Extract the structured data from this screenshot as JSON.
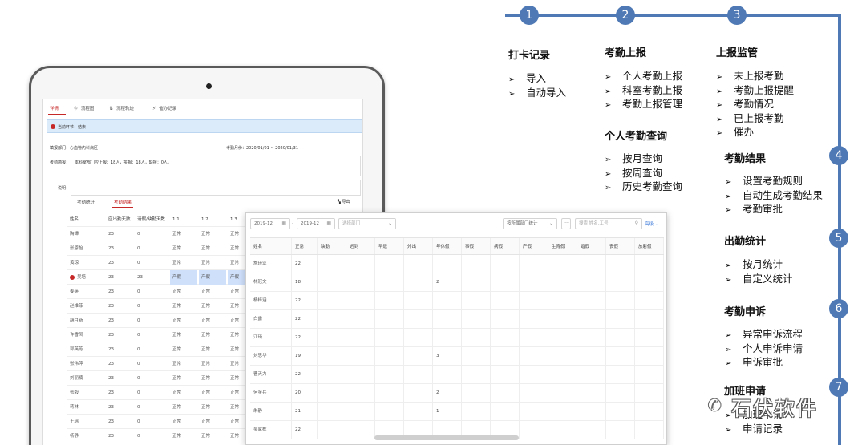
{
  "tablet": {
    "tabs": [
      {
        "icon": "",
        "label": "详情"
      },
      {
        "icon": "⛗",
        "label": "流程图"
      },
      {
        "icon": "⇅",
        "label": "流程轨迹"
      },
      {
        "icon": "⚡",
        "label": "催办记录"
      }
    ],
    "status": "当前环节：结束",
    "dept_label": "填报部门：心血管内科病区",
    "month_label": "考勤月份：2020/01/01 ~ 2020/01/31",
    "overview_label": "考勤简报：",
    "overview_text": "本科室部门应上报：18人，实报：18人，缺报：0人。",
    "remark_label": "说明：",
    "subtabs": [
      "考勤统计",
      "考勤结果"
    ],
    "export_label": "导出",
    "columns": [
      "姓名",
      "应出勤天数",
      "请假/缺勤天数",
      "1.1",
      "1.2",
      "1.3"
    ],
    "rows": [
      {
        "name": "陶谭",
        "days": "23",
        "leave": "0",
        "d1": "正常",
        "d2": "正常",
        "d3": "正常"
      },
      {
        "name": "张恩怡",
        "days": "23",
        "leave": "0",
        "d1": "正常",
        "d2": "正常",
        "d3": "正常"
      },
      {
        "name": "黄琼",
        "days": "23",
        "leave": "0",
        "d1": "正常",
        "d2": "正常",
        "d3": "正常"
      },
      {
        "name": "吴培",
        "days": "23",
        "leave": "23",
        "d1": "产假",
        "d2": "产假",
        "d3": "产假",
        "flag": true
      },
      {
        "name": "姜英",
        "days": "23",
        "leave": "0",
        "d1": "正常",
        "d2": "正常",
        "d3": "正常"
      },
      {
        "name": "赵维菲",
        "days": "23",
        "leave": "0",
        "d1": "正常",
        "d2": "正常",
        "d3": "正常"
      },
      {
        "name": "胡月新",
        "days": "23",
        "leave": "0",
        "d1": "正常",
        "d2": "正常",
        "d3": "正常"
      },
      {
        "name": "许雪凤",
        "days": "23",
        "leave": "0",
        "d1": "正常",
        "d2": "正常",
        "d3": "正常"
      },
      {
        "name": "郭英芳",
        "days": "23",
        "leave": "0",
        "d1": "正常",
        "d2": "正常",
        "d3": "正常"
      },
      {
        "name": "张伟萍",
        "days": "23",
        "leave": "0",
        "d1": "正常",
        "d2": "正常",
        "d3": "正常"
      },
      {
        "name": "刘丽楠",
        "days": "23",
        "leave": "0",
        "d1": "正常",
        "d2": "正常",
        "d3": "正常"
      },
      {
        "name": "张毅",
        "days": "23",
        "leave": "0",
        "d1": "正常",
        "d2": "正常",
        "d3": "正常"
      },
      {
        "name": "蒋林",
        "days": "23",
        "leave": "0",
        "d1": "正常",
        "d2": "正常",
        "d3": "正常"
      },
      {
        "name": "王瑶",
        "days": "23",
        "leave": "0",
        "d1": "正常",
        "d2": "正常",
        "d3": "正常"
      },
      {
        "name": "杨静",
        "days": "23",
        "leave": "0",
        "d1": "正常",
        "d2": "正常",
        "d3": "正常"
      }
    ]
  },
  "overlay": {
    "date_from": "2019-12",
    "date_to": "2019-12",
    "date_separator": "-",
    "dept_placeholder": "选择部门",
    "stat_select": "按所属部门统计",
    "more_btn": "···",
    "search_placeholder": "搜索 姓名,工号",
    "advanced": "高级",
    "columns": [
      "姓名",
      "正常",
      "缺勤",
      "迟到",
      "早退",
      "外出",
      "年休假",
      "事假",
      "病假",
      "产假",
      "生育假",
      "婚假",
      "丧假",
      "放射假"
    ],
    "rows": [
      {
        "name": "詹瑾业",
        "normal": "22",
        "annual": ""
      },
      {
        "name": "林冠文",
        "normal": "18",
        "annual": "2"
      },
      {
        "name": "杨梓涵",
        "normal": "22",
        "annual": ""
      },
      {
        "name": "白露",
        "normal": "22",
        "annual": ""
      },
      {
        "name": "江琦",
        "normal": "22",
        "annual": ""
      },
      {
        "name": "刘思华",
        "normal": "19",
        "annual": "3"
      },
      {
        "name": "曹天力",
        "normal": "22",
        "annual": ""
      },
      {
        "name": "何金兵",
        "normal": "20",
        "annual": "2"
      },
      {
        "name": "朱静",
        "normal": "21",
        "annual": "1"
      },
      {
        "name": "吴家栋",
        "normal": "22",
        "annual": ""
      }
    ]
  },
  "panel": {
    "accent": "#4f79b5",
    "steps": [
      "1",
      "2",
      "3",
      "4",
      "5",
      "6",
      "7"
    ],
    "sections": [
      {
        "title": "打卡记录",
        "items": [
          "导入",
          "自动导入"
        ]
      },
      {
        "title": "考勤上报",
        "items": [
          "个人考勤上报",
          "科室考勤上报",
          "考勤上报管理"
        ]
      },
      {
        "title": "个人考勤查询",
        "items": [
          "按月查询",
          "按周查询",
          "历史考勤查询"
        ]
      },
      {
        "title": "上报监管",
        "items": [
          "未上报考勤",
          "考勤上报提醒",
          "考勤情况",
          "已上报考勤",
          "催办"
        ]
      },
      {
        "title": "考勤结果",
        "items": [
          "设置考勤规则",
          "自动生成考勤结果",
          "考勤审批"
        ]
      },
      {
        "title": "出勤统计",
        "items": [
          "按月统计",
          "自定义统计"
        ]
      },
      {
        "title": "考勤申诉",
        "items": [
          "异常申诉流程",
          "个人申诉申请",
          "申诉审批"
        ]
      },
      {
        "title": "加班申请",
        "items": [
          "加班申请",
          "申请记录"
        ]
      }
    ],
    "bullet": "➢"
  },
  "watermark": {
    "icon": "wechat-icon",
    "text": "石伏软件"
  }
}
